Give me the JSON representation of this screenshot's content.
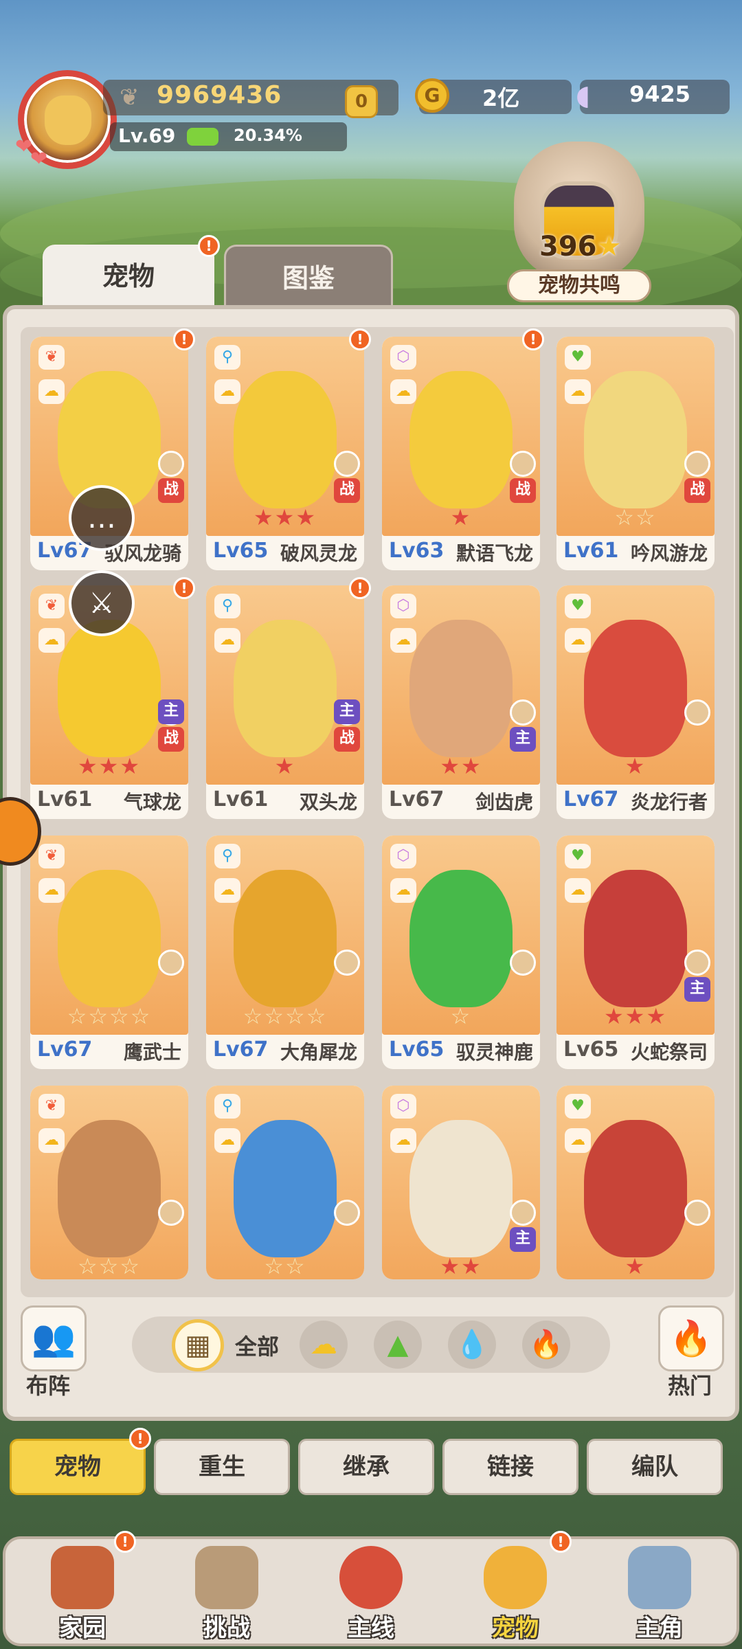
{
  "player": {
    "power": "9969436",
    "shield": "0",
    "level": "Lv.69",
    "exp_percent": "20.34%",
    "exp_fraction": 0.2034
  },
  "resources": {
    "gold": "2亿",
    "shells": "9425"
  },
  "resonance": {
    "count": "396",
    "label": "宠物共鸣"
  },
  "tabs": {
    "pets": "宠物",
    "atlas": "图鉴"
  },
  "pets": [
    {
      "lv": "Lv67",
      "name": "驭风龙骑",
      "stars": "",
      "tag": "战",
      "color": "#f3cf45",
      "lvColor": "#3f72c8"
    },
    {
      "lv": "Lv65",
      "name": "破风灵龙",
      "stars": "★★★",
      "tag": "战",
      "color": "#f3c93b",
      "lvColor": "#3f72c8"
    },
    {
      "lv": "Lv63",
      "name": "默语飞龙",
      "stars": "★",
      "tag": "战",
      "color": "#f4cb3d",
      "lvColor": "#3f72c8"
    },
    {
      "lv": "Lv61",
      "name": "吟风游龙",
      "stars": "☆☆",
      "tag": "战",
      "color": "#f1d77e",
      "lvColor": "#3f72c8"
    },
    {
      "lv": "Lv61",
      "name": "气球龙",
      "stars": "★★★",
      "tag": "主 战",
      "color": "#f5c930",
      "lvColor": "#5b5550"
    },
    {
      "lv": "Lv61",
      "name": "双头龙",
      "stars": "★",
      "tag": "主 战",
      "color": "#f1d062",
      "lvColor": "#5b5550"
    },
    {
      "lv": "Lv67",
      "name": "剑齿虎",
      "stars": "★★",
      "tag": "主",
      "color": "#e0a77a",
      "lvColor": "#5b5550"
    },
    {
      "lv": "Lv67",
      "name": "炎龙行者",
      "stars": "★",
      "tag": "",
      "color": "#d94c3e",
      "lvColor": "#3f72c8"
    },
    {
      "lv": "Lv67",
      "name": "鹰武士",
      "stars": "☆☆☆☆",
      "tag": "",
      "color": "#f3c13d",
      "lvColor": "#3f72c8"
    },
    {
      "lv": "Lv67",
      "name": "大角犀龙",
      "stars": "☆☆☆☆",
      "tag": "",
      "color": "#e6a52d",
      "lvColor": "#3f72c8"
    },
    {
      "lv": "Lv65",
      "name": "驭灵神鹿",
      "stars": "☆",
      "tag": "",
      "color": "#47b94a",
      "lvColor": "#3f72c8"
    },
    {
      "lv": "Lv65",
      "name": "火蛇祭司",
      "stars": "★★★",
      "tag": "主",
      "color": "#c63f3a",
      "lvColor": "#5b5550"
    },
    {
      "lv": "",
      "name": "",
      "stars": "☆☆☆",
      "tag": "",
      "color": "#c98a57",
      "lvColor": "#5b5550"
    },
    {
      "lv": "",
      "name": "",
      "stars": "☆☆",
      "tag": "",
      "color": "#4a8fd6",
      "lvColor": "#5b5550"
    },
    {
      "lv": "",
      "name": "",
      "stars": "★★",
      "tag": "主",
      "color": "#efe4cf",
      "lvColor": "#5b5550"
    },
    {
      "lv": "",
      "name": "",
      "stars": "★",
      "tag": "",
      "color": "#c84438",
      "lvColor": "#5b5550"
    }
  ],
  "filter": {
    "team": "布阵",
    "all": "全部",
    "hot": "热门"
  },
  "actions": [
    "宠物",
    "重生",
    "继承",
    "链接",
    "编队"
  ],
  "nav": [
    "家园",
    "挑战",
    "主线",
    "宠物",
    "主角"
  ]
}
